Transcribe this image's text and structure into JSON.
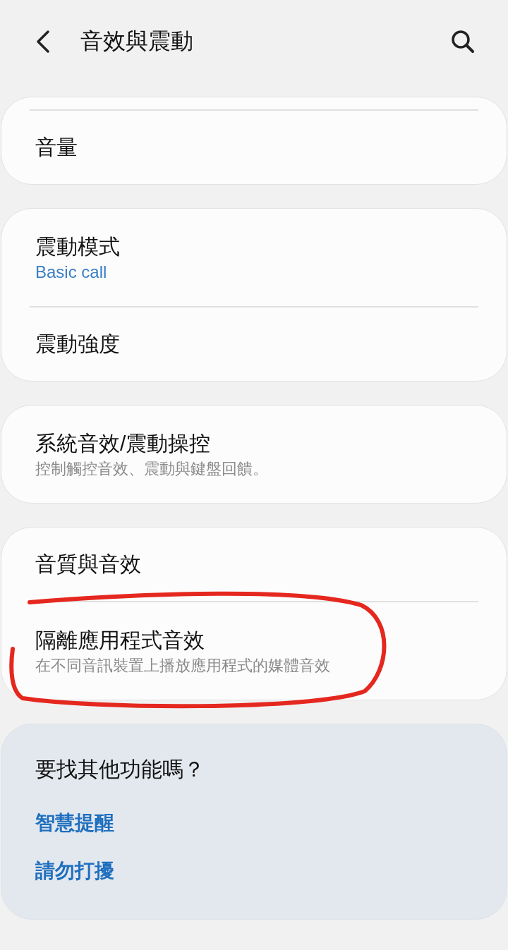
{
  "header": {
    "title": "音效與震動"
  },
  "groups": [
    {
      "top_divider": true,
      "items": [
        {
          "title": "音量",
          "circled": false
        }
      ]
    },
    {
      "top_divider": false,
      "items": [
        {
          "title": "震動模式",
          "subtitle": "Basic call",
          "kind": "value",
          "circled": false
        },
        {
          "title": "震動強度",
          "circled": false
        }
      ]
    },
    {
      "top_divider": false,
      "items": [
        {
          "title": "系統音效/震動操控",
          "subtitle": "控制觸控音效、震動與鍵盤回饋。",
          "kind": "description",
          "circled": false
        }
      ]
    },
    {
      "top_divider": false,
      "items": [
        {
          "title": "音質與音效",
          "circled": false
        },
        {
          "title": "隔離應用程式音效",
          "subtitle": "在不同音訊裝置上播放應用程式的媒體音效",
          "kind": "description",
          "circled": true
        }
      ]
    }
  ],
  "suggestions": {
    "title": "要找其他功能嗎？",
    "links": [
      "智慧提醒",
      "請勿打擾"
    ]
  }
}
